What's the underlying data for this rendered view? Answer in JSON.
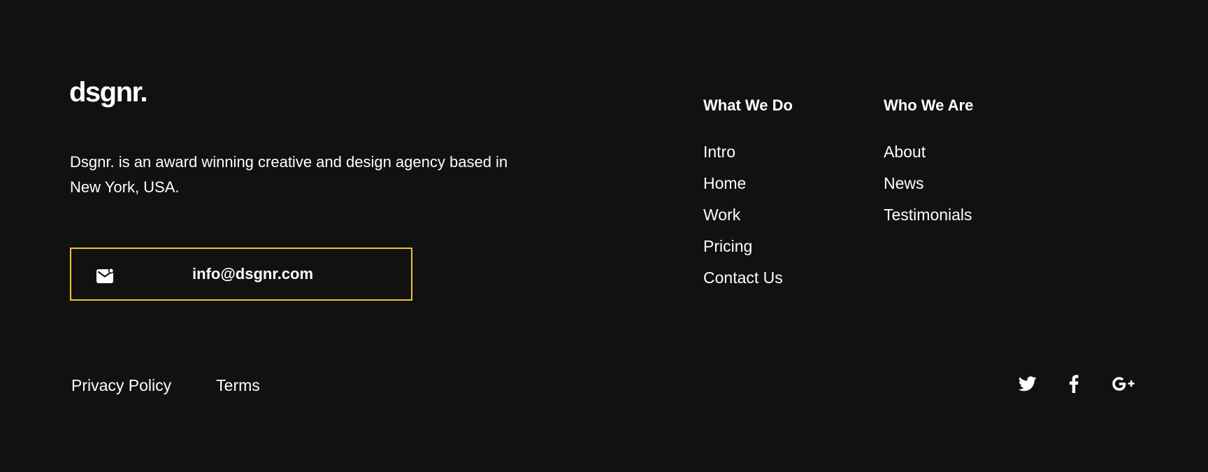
{
  "brand": {
    "logo": "dsgnr.",
    "tagline": "Dsgnr. is an award winning creative and design agency based in New York, USA."
  },
  "contact": {
    "email": "info@dsgnr.com",
    "icon": "mail-icon",
    "border_color": "#f2c230"
  },
  "nav_columns": [
    {
      "heading": "What We Do",
      "links": [
        "Intro",
        "Home",
        "Work",
        "Pricing",
        "Contact Us"
      ]
    },
    {
      "heading": "Who We Are",
      "links": [
        "About",
        "News",
        "Testimonials"
      ]
    }
  ],
  "legal": {
    "privacy": "Privacy Policy",
    "terms": "Terms"
  },
  "social": [
    {
      "name": "twitter-icon"
    },
    {
      "name": "facebook-icon"
    },
    {
      "name": "google-plus-icon"
    }
  ],
  "colors": {
    "background": "#111111",
    "text": "#ffffff",
    "accent": "#f2c230"
  }
}
